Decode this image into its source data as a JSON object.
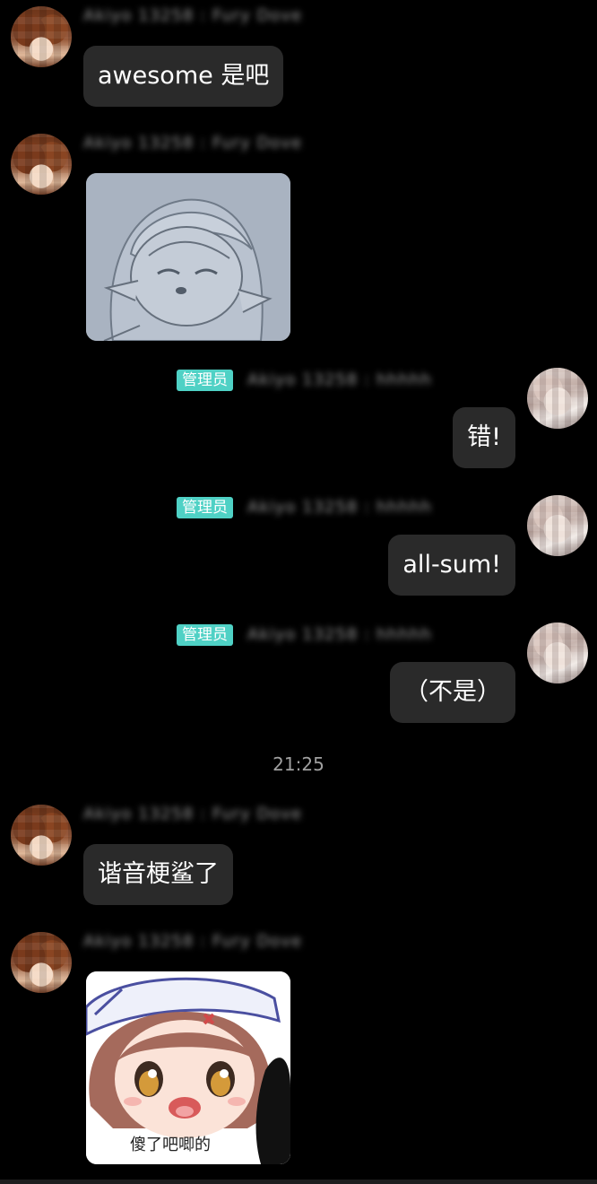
{
  "app": {
    "background": "#000000",
    "admin_badge_color": "#4fd1c5",
    "bubble_color": "#2a2a2a"
  },
  "messages": [
    {
      "side": "left",
      "name": "Akiyo 13258 : Fury Dove",
      "text": "awesome 是吧"
    },
    {
      "side": "left",
      "name": "Akiyo 13258 : Fury Dove",
      "image": "sticker-sketch-girl"
    },
    {
      "side": "right",
      "badge": "管理员",
      "name": "Akiyo 13258 : hhhhh",
      "text": "错!"
    },
    {
      "side": "right",
      "badge": "管理员",
      "name": "Akiyo 13258 : hhhhh",
      "text": "all-sum!"
    },
    {
      "side": "right",
      "badge": "管理员",
      "name": "Akiyo 13258 : hhhhh",
      "text": "（不是）"
    }
  ],
  "timestamp": "21:25",
  "messages_after": [
    {
      "side": "left",
      "name": "Akiyo 13258 : Fury Dove",
      "text": "谐音梗鲨了"
    },
    {
      "side": "left",
      "name": "Akiyo 13258 : Fury Dove",
      "image": "sticker-anime-girl",
      "caption": "傻了吧唧的"
    }
  ]
}
